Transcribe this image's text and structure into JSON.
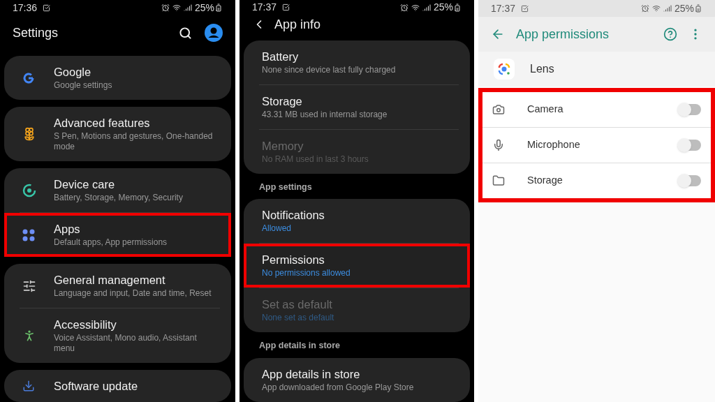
{
  "screens": [
    {
      "kind": "settings",
      "status_bar": {
        "time": "17:36",
        "battery": "25%"
      },
      "title": "Settings",
      "groups": [
        {
          "items": [
            {
              "kind": "google",
              "title": "Google",
              "subtitle": "Google settings",
              "disabled": false,
              "accent": false,
              "highlighted": false
            }
          ]
        },
        {
          "items": [
            {
              "kind": "advanced",
              "title": "Advanced features",
              "subtitle": "S Pen, Motions and gestures, One-handed mode",
              "disabled": false,
              "accent": false,
              "highlighted": false
            }
          ]
        },
        {
          "items": [
            {
              "kind": "device-care",
              "title": "Device care",
              "subtitle": "Battery, Storage, Memory, Security",
              "disabled": false,
              "accent": false,
              "highlighted": false
            },
            {
              "kind": "apps",
              "title": "Apps",
              "subtitle": "Default apps, App permissions",
              "disabled": false,
              "accent": false,
              "highlighted": true
            }
          ]
        },
        {
          "items": [
            {
              "kind": "sliders",
              "title": "General management",
              "subtitle": "Language and input, Date and time, Reset",
              "disabled": false,
              "accent": false,
              "highlighted": false
            },
            {
              "kind": "accessibility",
              "title": "Accessibility",
              "subtitle": "Voice Assistant, Mono audio, Assistant menu",
              "disabled": false,
              "accent": false,
              "highlighted": false
            }
          ]
        },
        {
          "items": [
            {
              "kind": "update",
              "title": "Software update",
              "disabled": false,
              "highlighted": false
            }
          ]
        }
      ]
    },
    {
      "kind": "app-info",
      "status_bar": {
        "time": "17:37",
        "battery": "25%"
      },
      "title": "App info",
      "groups": [
        {
          "items": [
            {
              "title": "Battery",
              "subtitle": "None since device last fully charged",
              "disabled": false,
              "accent": false,
              "highlighted": false
            },
            {
              "title": "Storage",
              "subtitle": "43.31 MB used in internal storage",
              "disabled": false,
              "accent": false,
              "highlighted": false
            },
            {
              "title": "Memory",
              "subtitle": "No RAM used in last 3 hours",
              "disabled": true,
              "accent": false,
              "highlighted": false
            }
          ]
        },
        {
          "header": "App settings",
          "items": [
            {
              "title": "Notifications",
              "subtitle": "Allowed",
              "disabled": false,
              "accent": true,
              "highlighted": false
            },
            {
              "title": "Permissions",
              "subtitle": "No permissions allowed",
              "disabled": false,
              "accent": true,
              "highlighted": true
            },
            {
              "title": "Set as default",
              "subtitle": "None set as default",
              "disabled": true,
              "accent": true,
              "highlighted": false
            }
          ]
        },
        {
          "header": "App details in store",
          "items": [
            {
              "title": "App details in store",
              "subtitle": "App downloaded from Google Play Store",
              "disabled": false,
              "accent": false,
              "highlighted": false
            }
          ]
        }
      ]
    },
    {
      "kind": "permissions",
      "status_bar": {
        "time": "17:37",
        "battery": "25%"
      },
      "title": "App permissions",
      "app": "Lens",
      "highlighted": true,
      "permissions": [
        {
          "kind": "camera",
          "label": "Camera",
          "on": false
        },
        {
          "kind": "mic",
          "label": "Microphone",
          "on": false
        },
        {
          "kind": "folder",
          "label": "Storage",
          "on": false
        }
      ]
    }
  ]
}
